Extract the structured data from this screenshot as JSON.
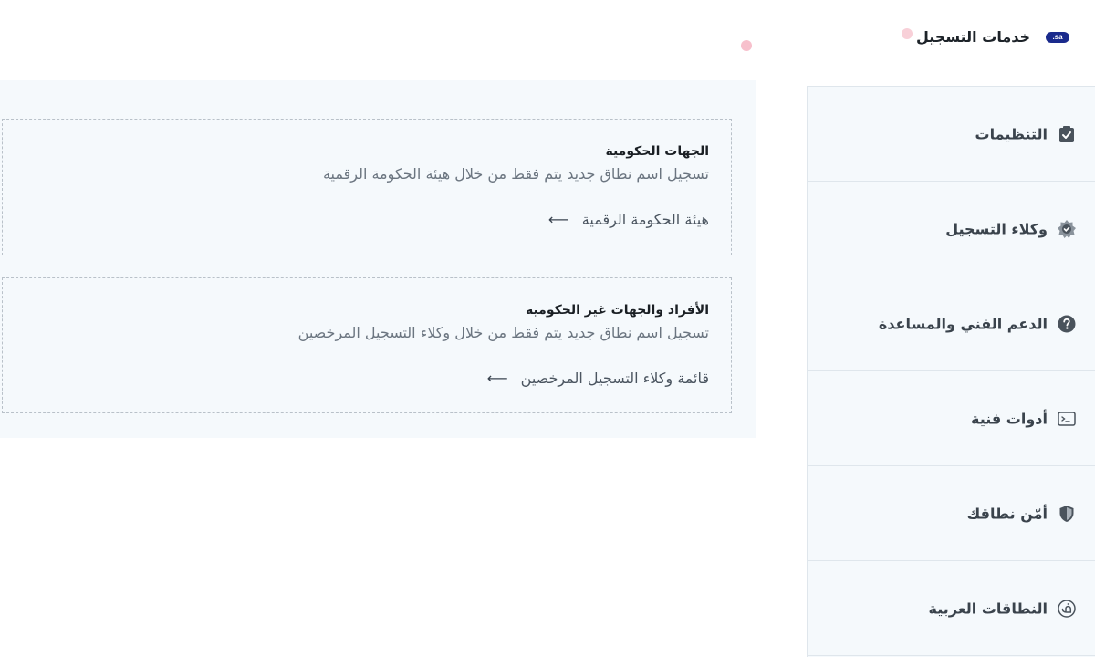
{
  "header": {
    "title": "خدمات التسجيل",
    "badge": ".sa"
  },
  "cards": [
    {
      "title": "الجهات الحكومية",
      "description": "تسجيل اسم نطاق جديد يتم فقط من خلال هيئة الحكومة الرقمية",
      "link_label": "هيئة الحكومة الرقمية"
    },
    {
      "title": "الأفراد والجهات غير الحكومية",
      "description": "تسجيل اسم نطاق جديد يتم فقط من خلال وكلاء التسجيل المرخصين",
      "link_label": "قائمة وكلاء التسجيل المرخصين"
    }
  ],
  "sidebar": {
    "items": [
      {
        "label": "التنظيمات",
        "icon": "clipboard-check-icon"
      },
      {
        "label": "وكلاء التسجيل",
        "icon": "badge-check-icon"
      },
      {
        "label": "الدعم الفني والمساعدة",
        "icon": "help-circle-icon"
      },
      {
        "label": "أدوات فنية",
        "icon": "terminal-icon"
      },
      {
        "label": "أمّن نطاقك",
        "icon": "shield-icon"
      },
      {
        "label": "النطاقات العربية",
        "icon": "arabic-letter-icon"
      }
    ]
  },
  "colors": {
    "badge": "#1a2a8c",
    "panel_bg": "#f5f9fc",
    "border": "#dfe6ec"
  }
}
